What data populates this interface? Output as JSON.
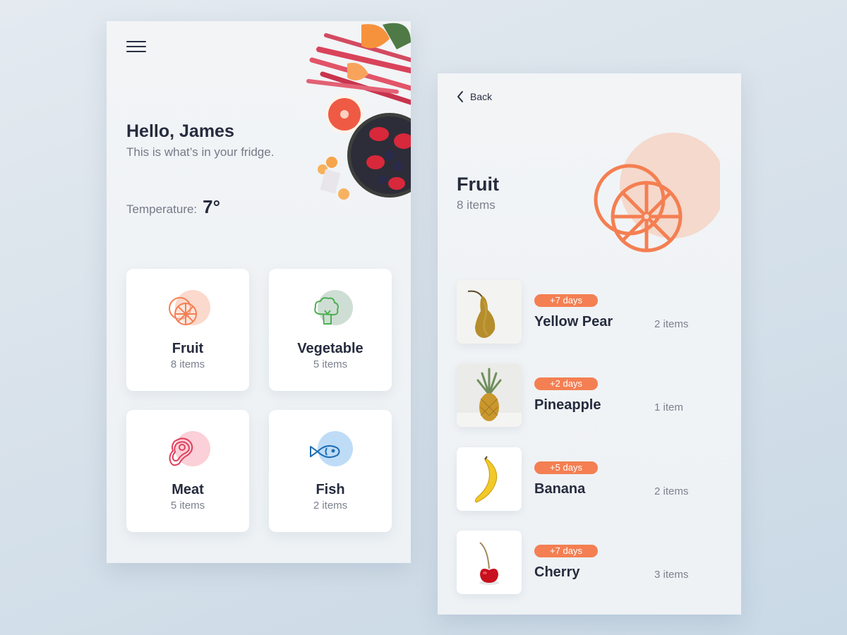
{
  "home": {
    "menu_icon": "hamburger-menu-icon",
    "greeting": "Hello, James",
    "subtitle": "This is what’s in your fridge.",
    "temperature_label": "Temperature:",
    "temperature_value": "7°",
    "categories": [
      {
        "name": "Fruit",
        "count": "8 items",
        "icon": "orange-slice-icon",
        "color": "#f47f52",
        "blob": "#fbd9cc"
      },
      {
        "name": "Vegetable",
        "count": "5 items",
        "icon": "broccoli-icon",
        "color": "#4caf50",
        "blob": "#cfded5"
      },
      {
        "name": "Meat",
        "count": "5 items",
        "icon": "steak-icon",
        "color": "#e0405e",
        "blob": "#fbd0d8"
      },
      {
        "name": "Fish",
        "count": "2 items",
        "icon": "fish-icon",
        "color": "#1e6eb5",
        "blob": "#bfdcf7"
      }
    ]
  },
  "detail": {
    "back_label": "Back",
    "title": "Fruit",
    "count": "8 items",
    "accent": "#f47f52",
    "items": [
      {
        "badge": "+7 days",
        "name": "Yellow Pear",
        "qty": "2 items",
        "image": "pear"
      },
      {
        "badge": "+2 days",
        "name": "Pineapple",
        "qty": "1 item",
        "image": "pineapple"
      },
      {
        "badge": "+5 days",
        "name": "Banana",
        "qty": "2 items",
        "image": "banana"
      },
      {
        "badge": "+7 days",
        "name": "Cherry",
        "qty": "3 items",
        "image": "cherry"
      }
    ]
  }
}
